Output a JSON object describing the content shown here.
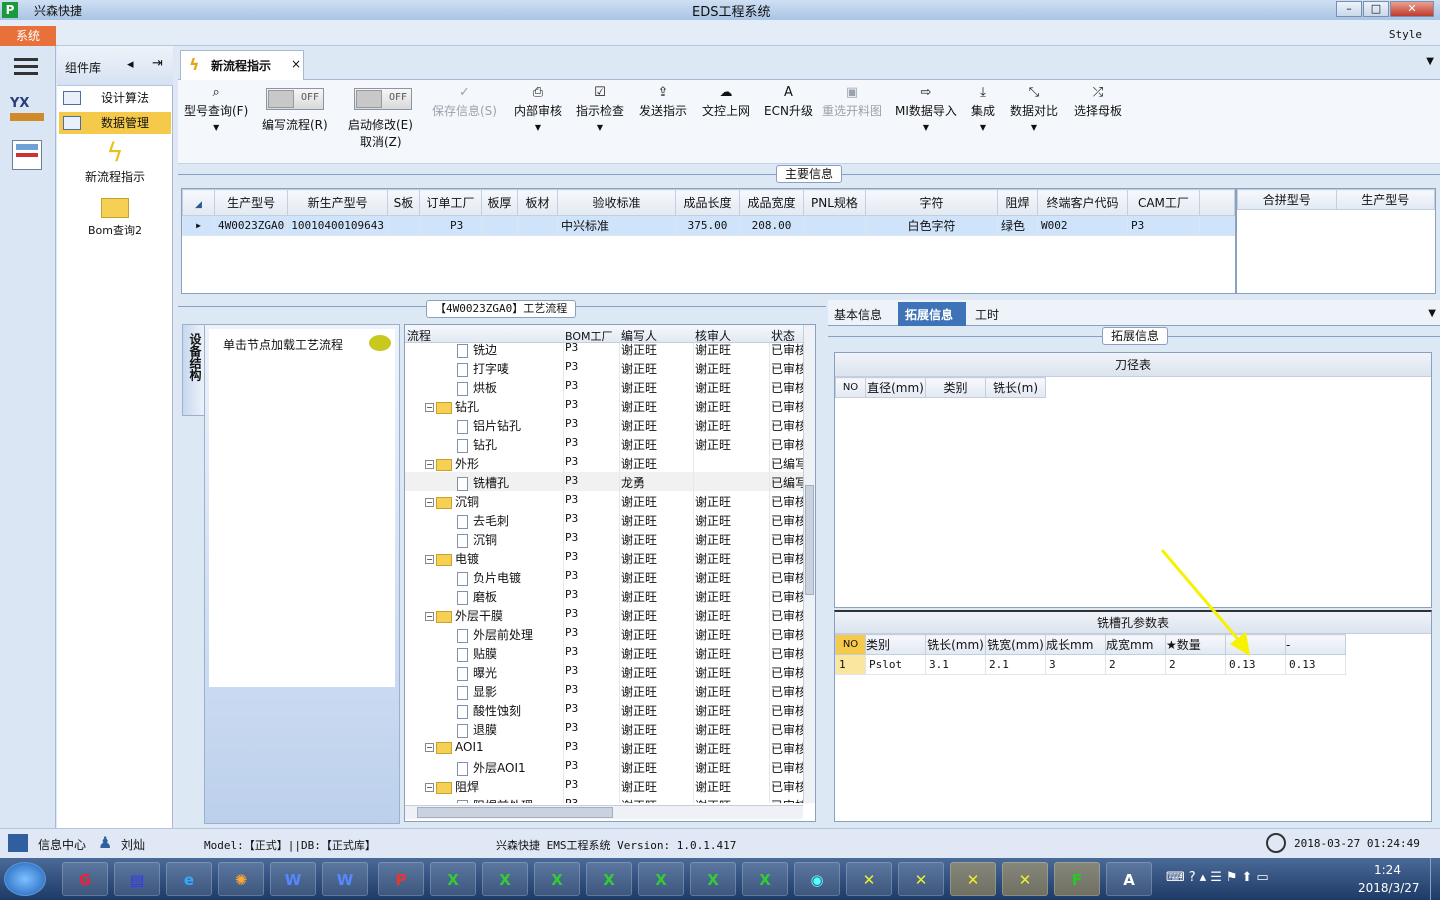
{
  "window": {
    "app_name": "兴森快捷",
    "title": "EDS工程系统"
  },
  "menu": {
    "system": "系统",
    "style": "Style"
  },
  "components": {
    "header": "组件库",
    "items": [
      {
        "label": "设计算法"
      },
      {
        "label": "数据管理"
      }
    ],
    "tiles": [
      {
        "label": "新流程指示"
      },
      {
        "label": "Bom查询2"
      }
    ]
  },
  "doc_tab": {
    "label": "新流程指示",
    "close": "×"
  },
  "toolbar": {
    "buttons": [
      {
        "label": "型号查询(F)",
        "icon": "search-icon"
      },
      {
        "label": "编写流程(R)",
        "toggle": "OFF"
      },
      {
        "label": "启动修改(E)",
        "label2": "取消(Z)",
        "toggle": "OFF"
      },
      {
        "label": "保存信息(S)",
        "icon": "check-icon"
      },
      {
        "label": "内部审核",
        "icon": "printer-icon"
      },
      {
        "label": "指示检查",
        "icon": "checkbox-icon"
      },
      {
        "label": "发送指示",
        "icon": "upload-icon"
      },
      {
        "label": "文控上网",
        "icon": "cloud-upload-icon"
      },
      {
        "label": "ECN升级",
        "icon": "ecn-icon"
      },
      {
        "label": "重选开料图",
        "icon": "image-icon"
      },
      {
        "label": "MI数据导入",
        "icon": "import-icon"
      },
      {
        "label": "集成",
        "icon": "download-icon"
      },
      {
        "label": "数据对比",
        "icon": "compare-icon"
      },
      {
        "label": "选择母板",
        "icon": "shuffle-icon"
      }
    ]
  },
  "main_info": {
    "title": "主要信息",
    "columns": [
      "生产型号",
      "新生产型号",
      "S板",
      "订单工厂",
      "板厚",
      "板材",
      "验收标准",
      "成品长度",
      "成品宽度",
      "PNL规格",
      "字符",
      "阻焊",
      "终端客户代码",
      "CAM工厂"
    ],
    "rows": [
      [
        "4W0023ZGA0",
        "10010400109643",
        "",
        "P3",
        "",
        "",
        "中兴标准",
        "375.00",
        "208.00",
        "",
        "白色字符",
        "绿色",
        "W002",
        "P3"
      ]
    ],
    "side_columns": [
      "合拼型号",
      "生产型号"
    ]
  },
  "process": {
    "title": "【4W0023ZGA0】工艺流程",
    "vertical_tab": "设备结构",
    "load_label": "单击节点加载工艺流程",
    "columns": [
      "流程",
      "BOM工厂",
      "编写人",
      "核审人",
      "状态"
    ],
    "rows": [
      {
        "name": "铣边",
        "level": 2,
        "type": "doc",
        "factory": "P3",
        "writer": "谢正旺",
        "reviewer": "谢正旺",
        "status": "已审核"
      },
      {
        "name": "打字唛",
        "level": 2,
        "type": "doc",
        "factory": "P3",
        "writer": "谢正旺",
        "reviewer": "谢正旺",
        "status": "已审核"
      },
      {
        "name": "烘板",
        "level": 2,
        "type": "doc",
        "factory": "P3",
        "writer": "谢正旺",
        "reviewer": "谢正旺",
        "status": "已审核"
      },
      {
        "name": "钻孔",
        "level": 1,
        "type": "folder",
        "factory": "P3",
        "writer": "谢正旺",
        "reviewer": "谢正旺",
        "status": "已审核"
      },
      {
        "name": "铝片钻孔",
        "level": 2,
        "type": "doc",
        "factory": "P3",
        "writer": "谢正旺",
        "reviewer": "谢正旺",
        "status": "已审核"
      },
      {
        "name": "钻孔",
        "level": 2,
        "type": "doc",
        "factory": "P3",
        "writer": "谢正旺",
        "reviewer": "谢正旺",
        "status": "已审核"
      },
      {
        "name": "外形",
        "level": 1,
        "type": "folder",
        "factory": "P3",
        "writer": "谢正旺",
        "reviewer": "",
        "status": "已编写"
      },
      {
        "name": "铣槽孔",
        "level": 2,
        "type": "doc",
        "factory": "P3",
        "writer": "龙勇",
        "reviewer": "",
        "status": "已编写"
      },
      {
        "name": "沉铜",
        "level": 1,
        "type": "folder",
        "factory": "P3",
        "writer": "谢正旺",
        "reviewer": "谢正旺",
        "status": "已审核"
      },
      {
        "name": "去毛刺",
        "level": 2,
        "type": "doc",
        "factory": "P3",
        "writer": "谢正旺",
        "reviewer": "谢正旺",
        "status": "已审核"
      },
      {
        "name": "沉铜",
        "level": 2,
        "type": "doc",
        "factory": "P3",
        "writer": "谢正旺",
        "reviewer": "谢正旺",
        "status": "已审核"
      },
      {
        "name": "电镀",
        "level": 1,
        "type": "folder",
        "factory": "P3",
        "writer": "谢正旺",
        "reviewer": "谢正旺",
        "status": "已审核"
      },
      {
        "name": "负片电镀",
        "level": 2,
        "type": "doc",
        "factory": "P3",
        "writer": "谢正旺",
        "reviewer": "谢正旺",
        "status": "已审核"
      },
      {
        "name": "磨板",
        "level": 2,
        "type": "doc",
        "factory": "P3",
        "writer": "谢正旺",
        "reviewer": "谢正旺",
        "status": "已审核"
      },
      {
        "name": "外层干膜",
        "level": 1,
        "type": "folder",
        "factory": "P3",
        "writer": "谢正旺",
        "reviewer": "谢正旺",
        "status": "已审核"
      },
      {
        "name": "外层前处理",
        "level": 2,
        "type": "doc",
        "factory": "P3",
        "writer": "谢正旺",
        "reviewer": "谢正旺",
        "status": "已审核"
      },
      {
        "name": "贴膜",
        "level": 2,
        "type": "doc",
        "factory": "P3",
        "writer": "谢正旺",
        "reviewer": "谢正旺",
        "status": "已审核"
      },
      {
        "name": "曝光",
        "level": 2,
        "type": "doc",
        "factory": "P3",
        "writer": "谢正旺",
        "reviewer": "谢正旺",
        "status": "已审核"
      },
      {
        "name": "显影",
        "level": 2,
        "type": "doc",
        "factory": "P3",
        "writer": "谢正旺",
        "reviewer": "谢正旺",
        "status": "已审核"
      },
      {
        "name": "酸性蚀刻",
        "level": 2,
        "type": "doc",
        "factory": "P3",
        "writer": "谢正旺",
        "reviewer": "谢正旺",
        "status": "已审核"
      },
      {
        "name": "退膜",
        "level": 2,
        "type": "doc",
        "factory": "P3",
        "writer": "谢正旺",
        "reviewer": "谢正旺",
        "status": "已审核"
      },
      {
        "name": "AOI1",
        "level": 1,
        "type": "folder",
        "factory": "P3",
        "writer": "谢正旺",
        "reviewer": "谢正旺",
        "status": "已审核"
      },
      {
        "name": "外层AOI1",
        "level": 2,
        "type": "doc",
        "factory": "P3",
        "writer": "谢正旺",
        "reviewer": "谢正旺",
        "status": "已审核"
      },
      {
        "name": "阻焊",
        "level": 1,
        "type": "folder",
        "factory": "P3",
        "writer": "谢正旺",
        "reviewer": "谢正旺",
        "status": "已审核"
      },
      {
        "name": "阻焊前处理",
        "level": 2,
        "type": "doc",
        "factory": "P3",
        "writer": "谢正旺",
        "reviewer": "谢正旺",
        "status": "已审核"
      }
    ]
  },
  "right_tabs": [
    "基本信息",
    "拓展信息",
    "工时"
  ],
  "ext": {
    "title": "拓展信息",
    "tool_table": {
      "title": "刀径表",
      "columns": [
        "NO",
        "直径(mm)",
        "类别",
        "铣长(m)"
      ]
    },
    "slot_table": {
      "title": "铣槽孔参数表",
      "columns": [
        "NO",
        "类别",
        "铣长(mm)",
        "铣宽(mm)",
        "成长mm",
        "成宽mm",
        "★数量",
        "",
        "-"
      ],
      "rows": [
        [
          "1",
          "Pslot",
          "3.1",
          "2.1",
          "3",
          "2",
          "2",
          "0.13",
          "0.13"
        ]
      ]
    }
  },
  "status": {
    "info_center": "信息中心",
    "user": "刘灿",
    "model": "Model:【正式】||DB:【正式库】",
    "version": "兴森快捷 EMS工程系统 Version: 1.0.1.417",
    "datetime": "2018-03-27 01:24:49"
  },
  "taskbar": {
    "time": "1:24",
    "date": "2018/3/27"
  },
  "colors": {
    "accent": "#e8703a",
    "selected": "#f5c949",
    "highlight_row": "#cfe3fa",
    "arrow": "#f7f200"
  }
}
